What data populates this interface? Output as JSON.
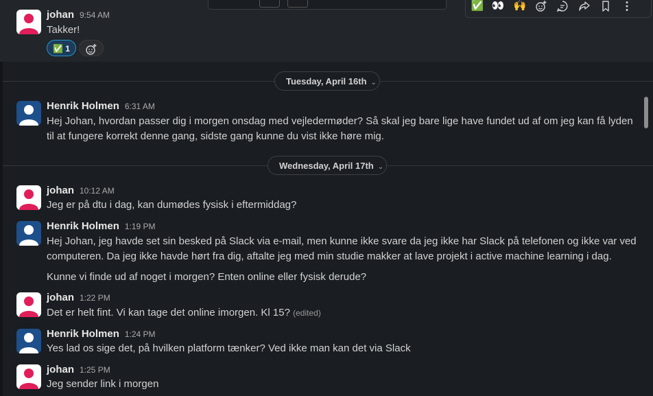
{
  "top_message": {
    "author": "johan",
    "time": "9:54 AM",
    "text": "Takker!",
    "reaction_emoji": "✅",
    "reaction_count": "1",
    "add_reaction_icon": "add-reaction-icon"
  },
  "toolbar": {
    "buttons": [
      {
        "name": "check-emoji",
        "glyph": "✅"
      },
      {
        "name": "eyes-emoji",
        "glyph": "👀"
      },
      {
        "name": "raised-hands-emoji",
        "glyph": "🙌"
      },
      {
        "name": "add-reaction-icon",
        "glyph": "☺"
      },
      {
        "name": "reply-in-thread-icon",
        "glyph": "💬"
      },
      {
        "name": "forward-icon",
        "glyph": "➦"
      },
      {
        "name": "bookmark-icon",
        "glyph": "🔖"
      },
      {
        "name": "more-actions-icon",
        "glyph": "⋮"
      }
    ]
  },
  "dividers": {
    "d1": "Tuesday, April 16th",
    "d2": "Wednesday, April 17th",
    "chevron": "⌄"
  },
  "messages": [
    {
      "author": "Henrik Holmen",
      "time": "6:31 AM",
      "text": "Hej Johan, hvordan passer dig i morgen onsdag med vejledermøder? Så skal jeg bare lige have fundet ud af om jeg kan få lyden til at fungere korrekt denne gang, sidste gang kunne du vist ikke høre mig."
    },
    {
      "author": "johan",
      "time": "10:12 AM",
      "text": "Jeg er på dtu i dag, kan dumødes fysisk i eftermiddag?"
    },
    {
      "author": "Henrik Holmen",
      "time": "1:19 PM",
      "text": "Hej Johan, jeg havde set sin besked på Slack via e-mail, men kunne ikke svare da jeg ikke har Slack på telefonen og ikke var ved computeren. Da jeg ikke havde hørt fra dig, aftalte jeg med min studie makker at lave projekt i active machine learning i dag.",
      "text2": "Kunne vi finde ud af noget i morgen? Enten online eller fysisk derude?"
    },
    {
      "author": "johan",
      "time": "1:22 PM",
      "text": "Det er helt fint. Vi kan tage det online imorgen. Kl 15?",
      "edited": "(edited)"
    },
    {
      "author": "Henrik Holmen",
      "time": "1:24 PM",
      "text": "Yes lad os sige det, på hvilken platform tænker? Ved ikke man kan det via Slack"
    },
    {
      "author": "johan",
      "time": "1:25 PM",
      "text": "Jeg sender link i morgen"
    }
  ]
}
